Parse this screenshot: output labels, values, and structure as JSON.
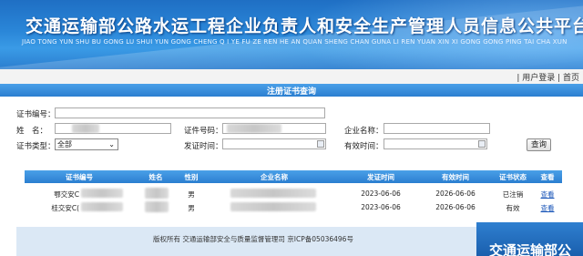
{
  "header": {
    "title": "交通运输部公路水运工程企业负责人和安全生产管理人员信息公共平台查询",
    "pinyin": "JIAO TONG YUN SHU BU GONG LU SHUI YUN GONG CHENG Q I YE FU ZE REN HE AN QUAN SHENG CHAN GUNA LI REN YUAN XIN XI GONG GONG PING TAI CHA XUN"
  },
  "toplinks": {
    "login": "| 用户登录",
    "home": "| 首页"
  },
  "section_title": "注册证书查询",
  "form": {
    "cert_no_label": "证书编号：",
    "name_label": "姓　名：",
    "cert_id_label": "证件号码：",
    "company_label": "企业名称：",
    "cert_type_label": "证书类型：",
    "cert_type_value": "全部",
    "issue_time_label": "发证时间：",
    "valid_time_label": "有效时间：",
    "search_button": "查询"
  },
  "table": {
    "headers": [
      "证书编号",
      "姓名",
      "性别",
      "企业名称",
      "发证时间",
      "有效时间",
      "证书状态",
      "查看"
    ],
    "rows": [
      {
        "cert_no": "鄂交安C",
        "gender": "男",
        "issue": "2023-06-06",
        "valid": "2026-06-06",
        "status": "已注销",
        "view": "查看"
      },
      {
        "cert_no": "桂交安C(",
        "gender": "男",
        "issue": "2023-06-06",
        "valid": "2026-06-06",
        "status": "有效",
        "view": "查看"
      }
    ]
  },
  "footer": {
    "text": "版权所有 交通运输部安全与质量监督管理司 京ICP备05036496号",
    "corner_text": "交通运输部公"
  },
  "colors": {
    "accent": "#2b7ed0",
    "banner": "#1f6fc4",
    "link": "#1a56b8",
    "footer_bg": "#dbe8f5"
  }
}
